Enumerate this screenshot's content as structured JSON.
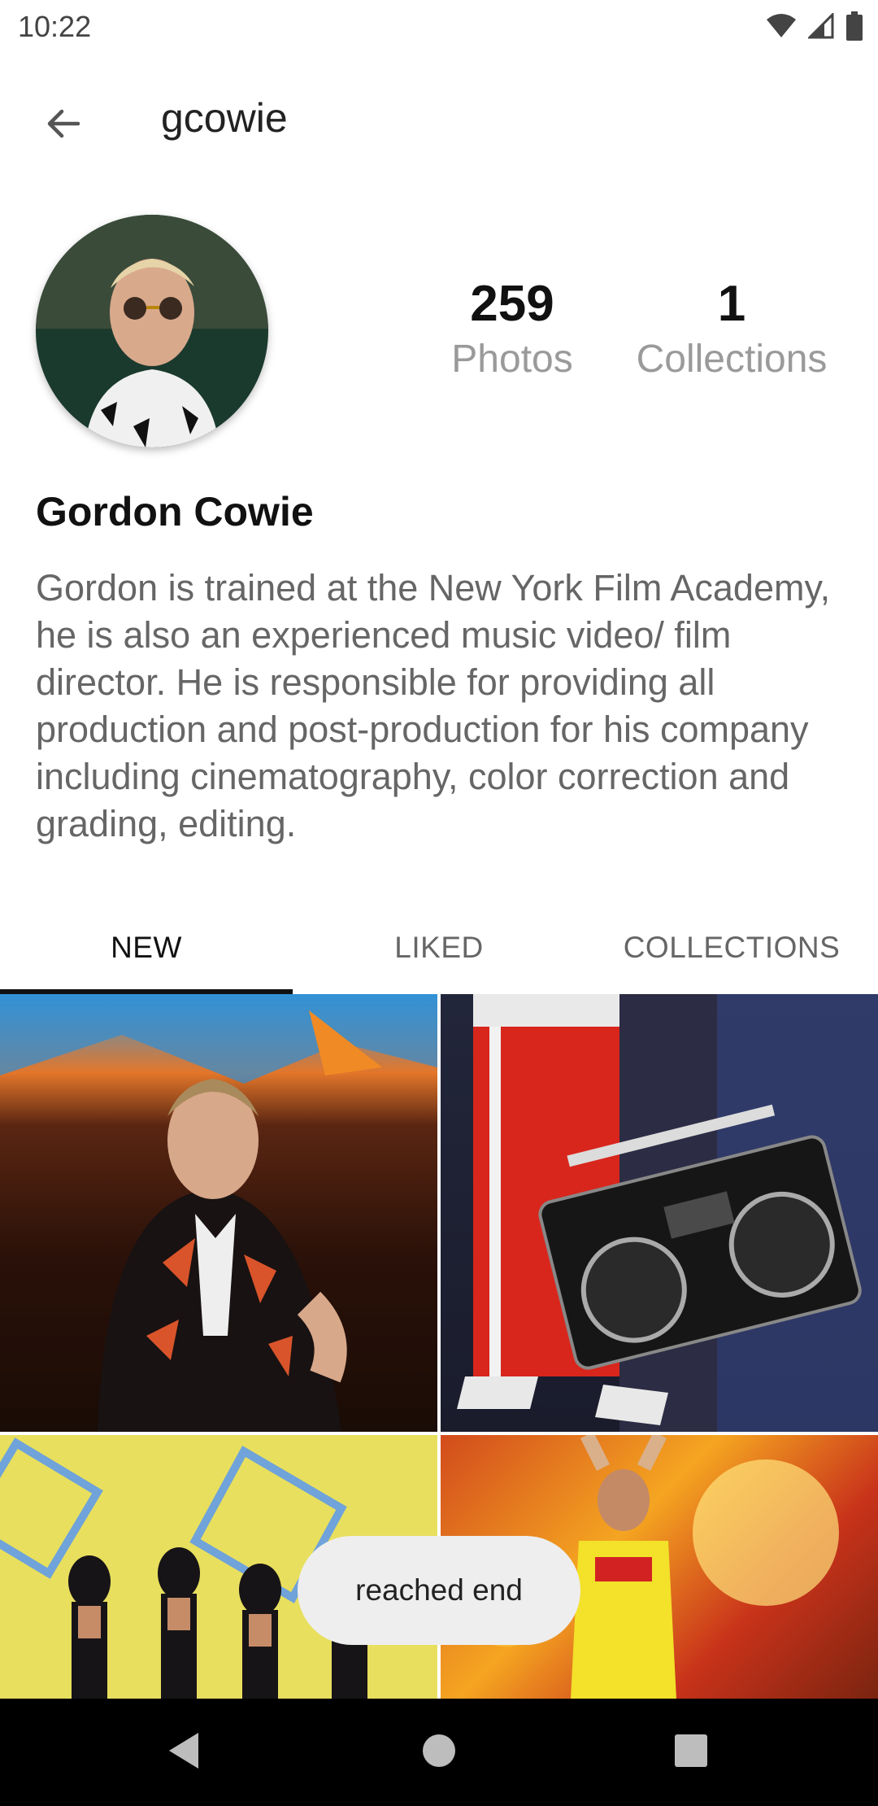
{
  "status_bar": {
    "time": "10:22",
    "icons": [
      "wifi-icon",
      "cellular-signal-icon",
      "battery-icon"
    ]
  },
  "app_bar": {
    "back_icon": "arrow-left-icon",
    "title": "gcowie"
  },
  "profile": {
    "name": "Gordon Cowie",
    "bio": "Gordon is trained at the New York Film Academy, he is also an experienced music video/ film director. He is responsible for providing all production and post-production for his company including cinematography, color correction and grading, editing.",
    "stats": {
      "photos_count": "259",
      "photos_label": "Photos",
      "collections_count": "1",
      "collections_label": "Collections"
    }
  },
  "tabs": [
    {
      "label": "NEW",
      "selected": true
    },
    {
      "label": "LIKED",
      "selected": false
    },
    {
      "label": "COLLECTIONS",
      "selected": false
    }
  ],
  "toast": {
    "text": "reached end"
  },
  "nav_bar": {
    "icons": [
      "nav-back-icon",
      "nav-home-icon",
      "nav-recents-icon"
    ]
  },
  "colors": {
    "background": "#ffffff",
    "tab_indicator": "#111111",
    "secondary_text": "#9a9a9a",
    "nav_bar": "#000000"
  }
}
